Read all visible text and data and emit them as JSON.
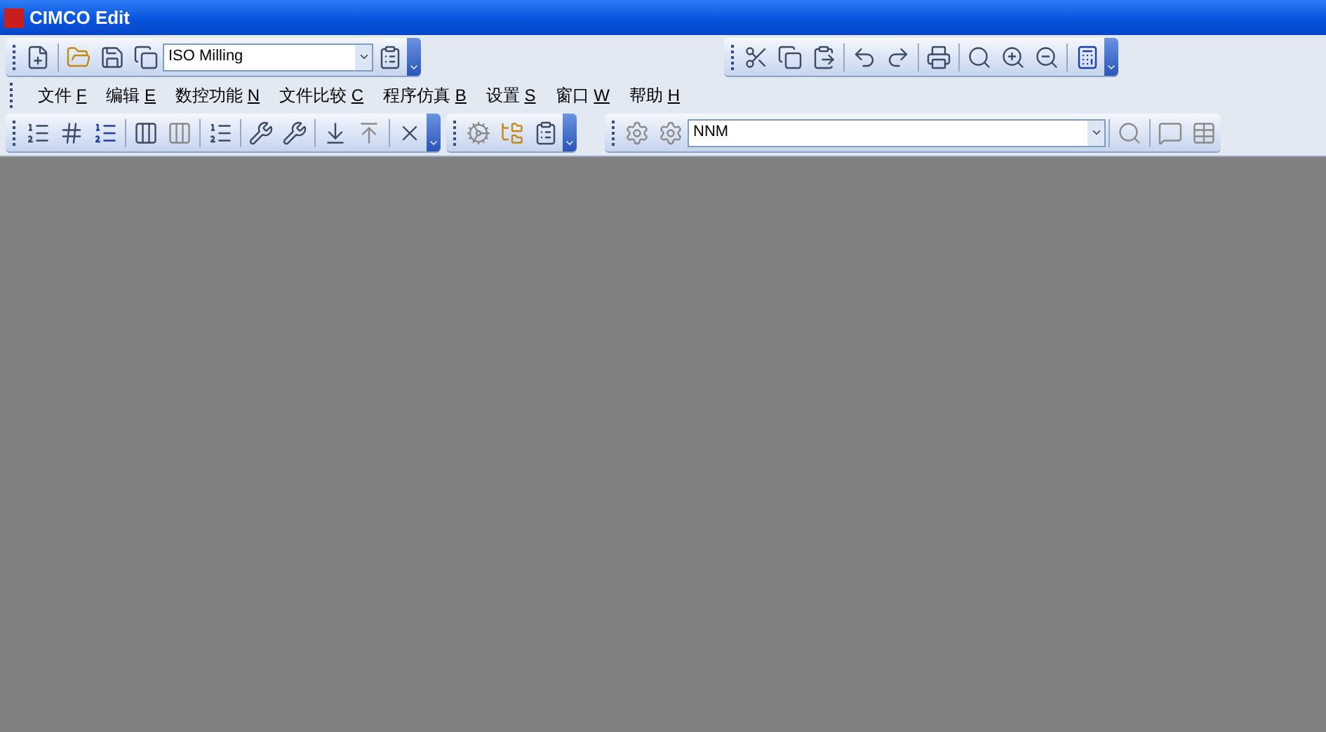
{
  "window": {
    "title": "CIMCO Edit"
  },
  "toolbar_file": {
    "machine_combo": {
      "value": "ISO Milling"
    }
  },
  "menu": [
    {
      "label": "文件",
      "key": "F"
    },
    {
      "label": "编辑",
      "key": "E"
    },
    {
      "label": "数控功能",
      "key": "N"
    },
    {
      "label": "文件比较",
      "key": "C"
    },
    {
      "label": "程序仿真",
      "key": "B"
    },
    {
      "label": "设置",
      "key": "S"
    },
    {
      "label": "窗口",
      "key": "W"
    },
    {
      "label": "帮助",
      "key": "H"
    }
  ],
  "toolbar_search": {
    "search_combo": {
      "value": "NNM"
    }
  }
}
